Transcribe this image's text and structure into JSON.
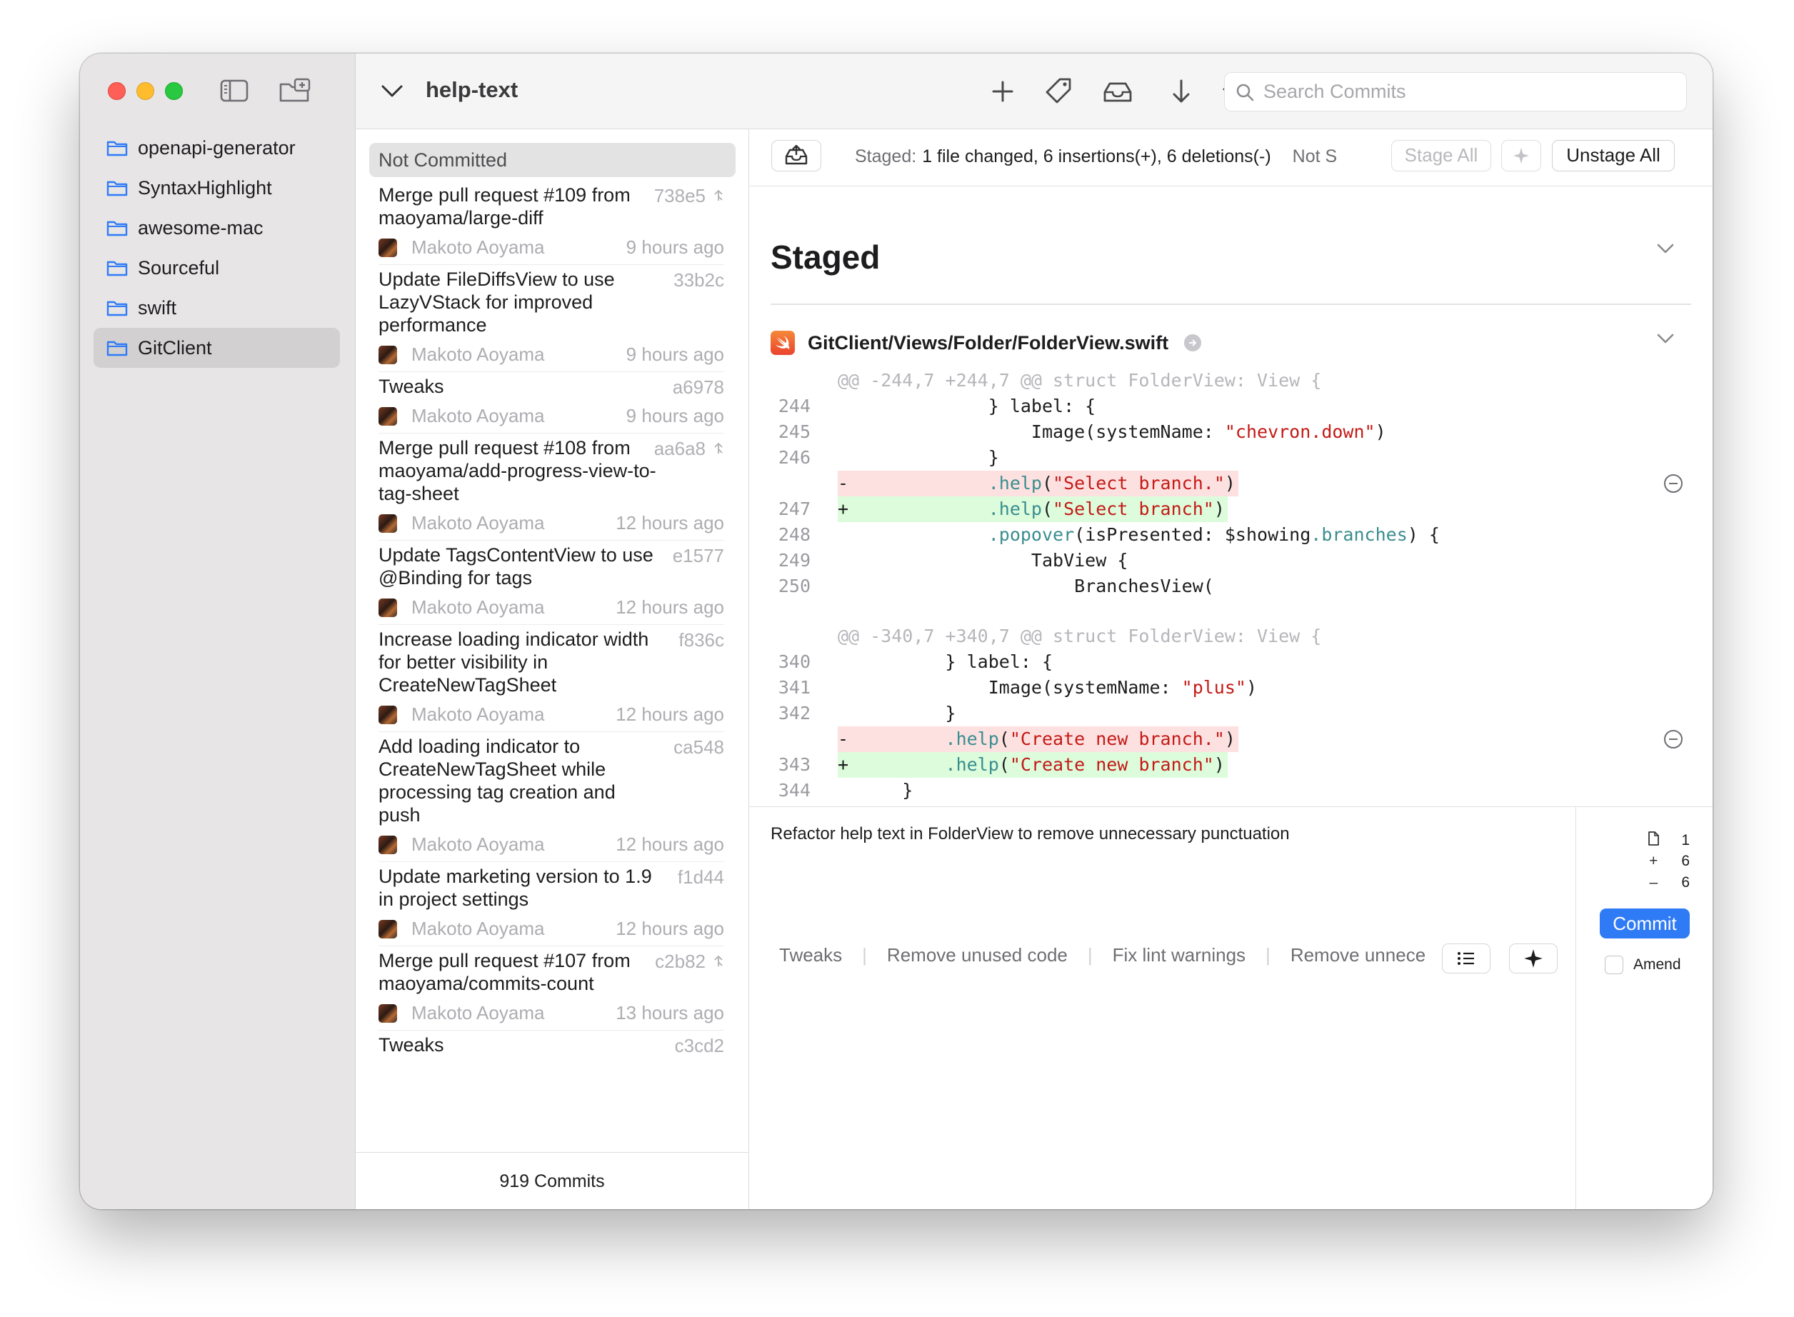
{
  "sidebar": {
    "items": [
      {
        "label": "openapi-generator"
      },
      {
        "label": "SyntaxHighlight"
      },
      {
        "label": "awesome-mac"
      },
      {
        "label": "Sourceful"
      },
      {
        "label": "swift"
      },
      {
        "label": "GitClient",
        "selected": true
      }
    ]
  },
  "toolbar": {
    "branch": "help-text",
    "search_placeholder": "Search Commits"
  },
  "commits": {
    "not_committed": "Not Committed",
    "list": [
      {
        "message": "Merge pull request #109 from maoyama/large-diff",
        "sha": "738e5",
        "merge": true,
        "author": "Makoto Aoyama",
        "time": "9 hours ago"
      },
      {
        "message": "Update FileDiffsView to use LazyVStack for improved performance",
        "sha": "33b2c",
        "merge": false,
        "author": "Makoto Aoyama",
        "time": "9 hours ago"
      },
      {
        "message": "Tweaks",
        "sha": "a6978",
        "merge": false,
        "author": "Makoto Aoyama",
        "time": "9 hours ago"
      },
      {
        "message": "Merge pull request #108 from maoyama/add-progress-view-to-tag-sheet",
        "sha": "aa6a8",
        "merge": true,
        "author": "Makoto Aoyama",
        "time": "12 hours ago"
      },
      {
        "message": "Update TagsContentView to use @Binding for tags",
        "sha": "e1577",
        "merge": false,
        "author": "Makoto Aoyama",
        "time": "12 hours ago"
      },
      {
        "message": "Increase loading indicator width for better visibility in CreateNewTagSheet",
        "sha": "f836c",
        "merge": false,
        "author": "Makoto Aoyama",
        "time": "12 hours ago"
      },
      {
        "message": "Add loading indicator to CreateNewTagSheet while processing tag creation and push",
        "sha": "ca548",
        "merge": false,
        "author": "Makoto Aoyama",
        "time": "12 hours ago"
      },
      {
        "message": "Update marketing version to 1.9 in project settings",
        "sha": "f1d44",
        "merge": false,
        "author": "Makoto Aoyama",
        "time": "12 hours ago"
      },
      {
        "message": "Merge pull request #107 from maoyama/commits-count",
        "sha": "c2b82",
        "merge": true,
        "author": "Makoto Aoyama",
        "time": "13 hours ago"
      },
      {
        "message": "Tweaks",
        "sha": "c3cd2",
        "merge": false,
        "author": "",
        "time": ""
      }
    ],
    "count_label": "919 Commits"
  },
  "stage_bar": {
    "staged_label": "Staged:",
    "summary": "1 file changed, 6 insertions(+), 6 deletions(-)",
    "not_staged_label": "Not S",
    "stage_all": "Stage All",
    "unstage_all": "Unstage All"
  },
  "diff": {
    "section_title": "Staged",
    "file_path": "GitClient/Views/Folder/FolderView.swift"
  },
  "message": {
    "text": "Refactor help text in FolderView to remove unnecessary punctuation",
    "stats": {
      "files": "1",
      "insertions": "6",
      "deletions": "6"
    },
    "commit_label": "Commit",
    "amend_label": "Amend",
    "suggestions": [
      "Tweaks",
      "Remove unused code",
      "Fix lint warnings",
      "Remove unnece"
    ]
  },
  "colors": {
    "accent": "#2f7bf6",
    "deletion_bg": "#fde1e1",
    "insertion_bg": "#dcfcdc",
    "string": "#c41a16",
    "method": "#3a8d8f",
    "keyword": "#ad3da4"
  }
}
